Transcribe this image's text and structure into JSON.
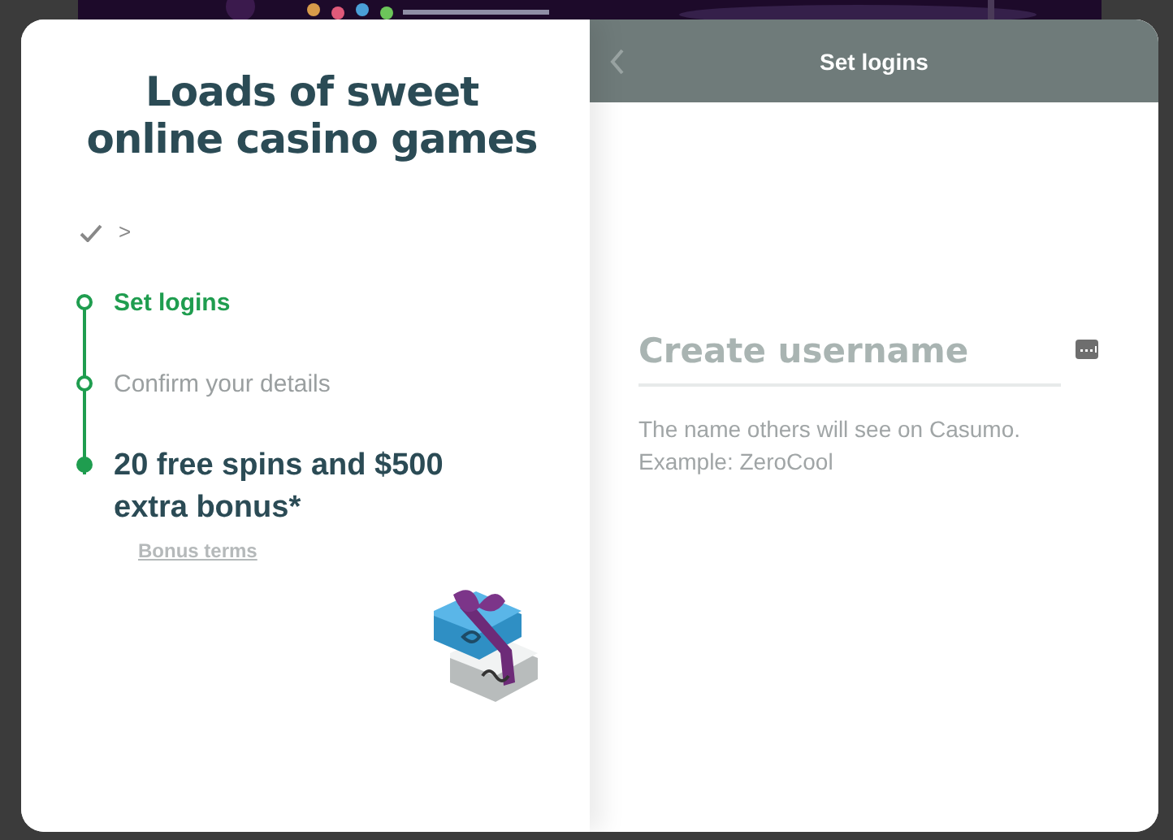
{
  "promo": {
    "title": "Loads of sweet online casino games",
    "steps": [
      {
        "kind": "done",
        "label": ">",
        "selected": false
      },
      {
        "kind": "step",
        "label": "Set logins",
        "selected": true
      },
      {
        "kind": "step",
        "label": "Confirm your details",
        "selected": false
      },
      {
        "kind": "reward",
        "label": "20 free spins and $500 extra bonus*",
        "selected": false
      }
    ],
    "terms_link": "Bonus terms"
  },
  "form": {
    "header": {
      "title": "Set logins"
    },
    "username": {
      "placeholder": "Create username",
      "help": "The name others will see on Casumo. Example: ZeroCool"
    }
  }
}
